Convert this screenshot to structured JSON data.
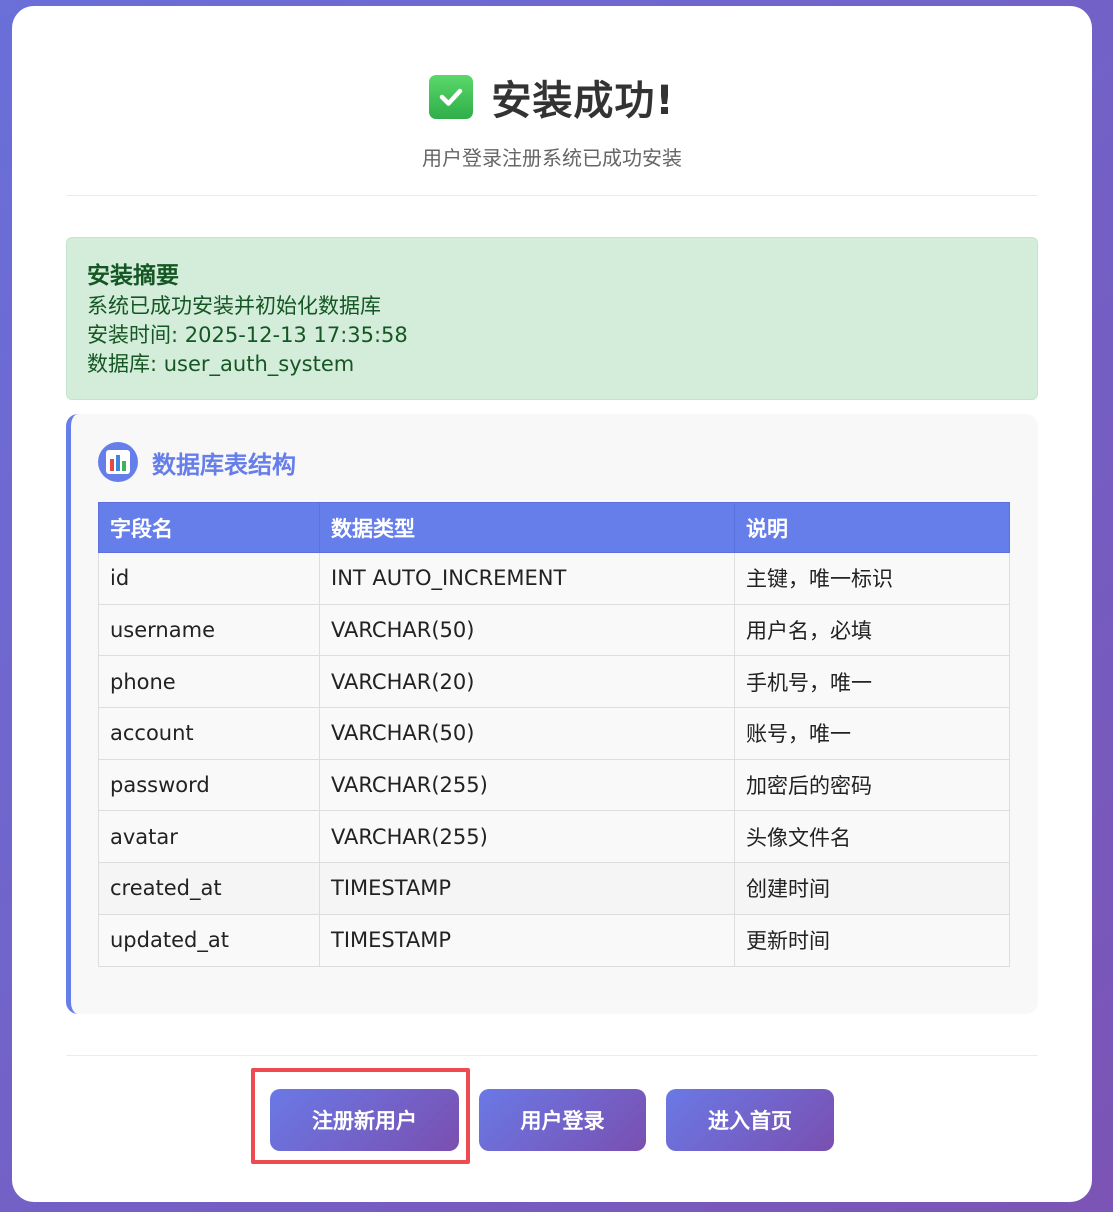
{
  "header": {
    "title": "安装成功!",
    "subtitle": "用户登录注册系统已成功安装"
  },
  "summary": {
    "title": "安装摘要",
    "line1": "系统已成功安装并初始化数据库",
    "line2": "安装时间: 2025-12-13 17:35:58",
    "line3": "数据库: user_auth_system"
  },
  "schema": {
    "title": "数据库表结构",
    "columns": [
      "字段名",
      "数据类型",
      "说明"
    ],
    "rows": [
      [
        "id",
        "INT AUTO_INCREMENT",
        "主键，唯一标识"
      ],
      [
        "username",
        "VARCHAR(50)",
        "用户名，必填"
      ],
      [
        "phone",
        "VARCHAR(20)",
        "手机号，唯一"
      ],
      [
        "account",
        "VARCHAR(50)",
        "账号，唯一"
      ],
      [
        "password",
        "VARCHAR(255)",
        "加密后的密码"
      ],
      [
        "avatar",
        "VARCHAR(255)",
        "头像文件名"
      ],
      [
        "created_at",
        "TIMESTAMP",
        "创建时间"
      ],
      [
        "updated_at",
        "TIMESTAMP",
        "更新时间"
      ]
    ]
  },
  "actions": {
    "register": "注册新用户",
    "login": "用户登录",
    "home": "进入首页"
  },
  "icons": {
    "title_icon": "check-mark-icon",
    "schema_icon": "bar-chart-icon"
  },
  "colors": {
    "accent": "#667eea",
    "success_bg": "#d4edda",
    "success_text": "#155724",
    "highlight": "#ee4a4f"
  }
}
